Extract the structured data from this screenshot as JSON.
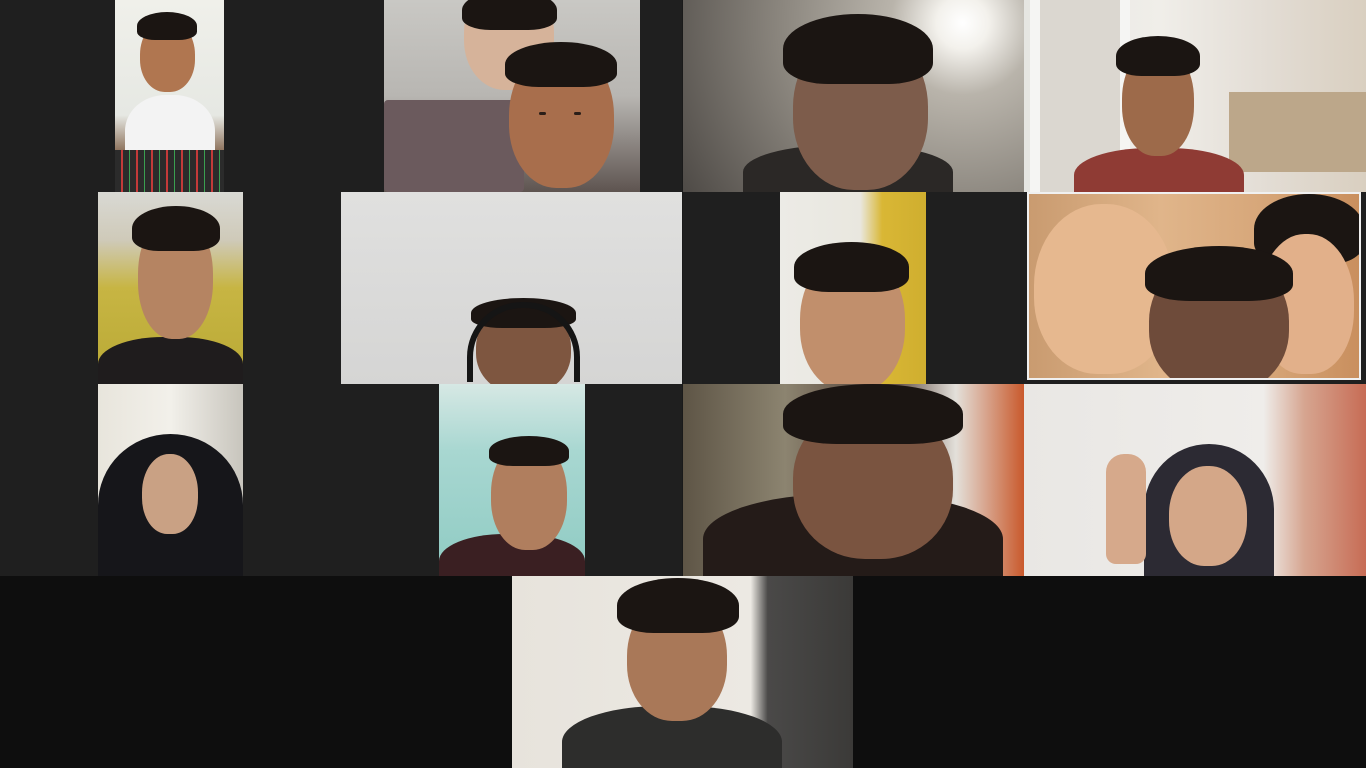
{
  "app": {
    "view": "gallery"
  },
  "participants": [
    {
      "id": 1,
      "tile": "r1c1"
    },
    {
      "id": 2,
      "tile": "r1c2"
    },
    {
      "id": 3,
      "tile": "r1c3"
    },
    {
      "id": 4,
      "tile": "r1c4"
    },
    {
      "id": 5,
      "tile": "r2c1"
    },
    {
      "id": 6,
      "tile": "r2c2"
    },
    {
      "id": 7,
      "tile": "r2c3"
    },
    {
      "id": 8,
      "tile": "r2c4"
    },
    {
      "id": 9,
      "tile": "r3c1"
    },
    {
      "id": 10,
      "tile": "r3c2"
    },
    {
      "id": 11,
      "tile": "r3c3"
    },
    {
      "id": 12,
      "tile": "r3c4"
    },
    {
      "id": 13,
      "tile": "r4c1"
    }
  ],
  "colors": {
    "background": "#1a1a1a",
    "tile": "#1f1f1f",
    "bottom_band": "#0e0e0e"
  }
}
